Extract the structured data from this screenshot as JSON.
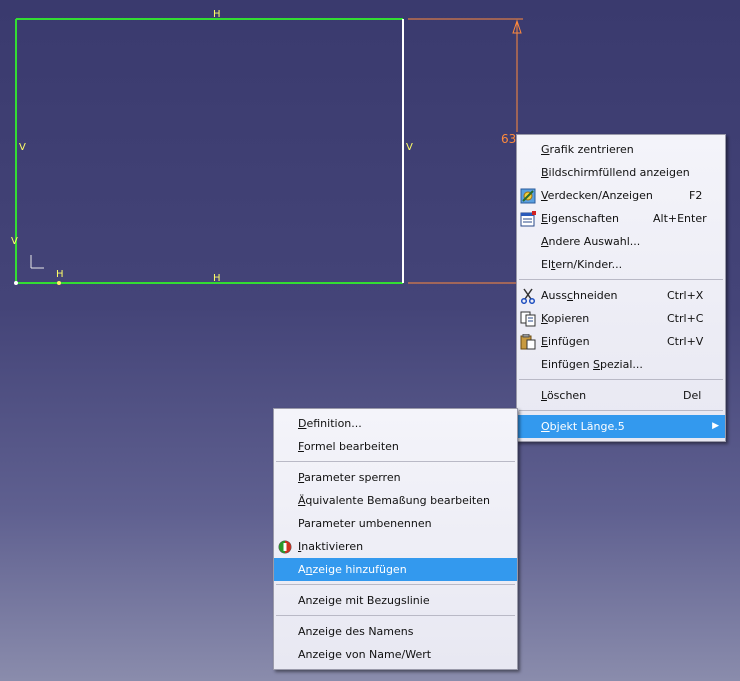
{
  "canvas": {
    "constraint_labels": {
      "top": "H",
      "bottom": "H",
      "left": "V",
      "right": "V",
      "origin_v": "V",
      "origin_h": "H"
    },
    "dimension_value": "63"
  },
  "context_menu": {
    "items": [
      {
        "pre": "",
        "u": "G",
        "post": "rafik zentrieren",
        "shortcut": ""
      },
      {
        "pre": "",
        "u": "B",
        "post": "ildschirmfüllend anzeigen",
        "shortcut": ""
      },
      {
        "pre": "",
        "u": "V",
        "post": "erdecken/Anzeigen",
        "shortcut": "F2"
      },
      {
        "pre": "",
        "u": "E",
        "post": "igenschaften",
        "shortcut": "Alt+Enter"
      },
      {
        "pre": "",
        "u": "A",
        "post": "ndere Auswahl...",
        "shortcut": ""
      },
      {
        "pre": "El",
        "u": "t",
        "post": "ern/Kinder...",
        "shortcut": ""
      },
      {
        "pre": "Auss",
        "u": "c",
        "post": "hneiden",
        "shortcut": "Ctrl+X"
      },
      {
        "pre": "",
        "u": "K",
        "post": "opieren",
        "shortcut": "Ctrl+C"
      },
      {
        "pre": "",
        "u": "E",
        "post": "infügen",
        "shortcut": "Ctrl+V"
      },
      {
        "pre": "Einfügen ",
        "u": "S",
        "post": "pezial...",
        "shortcut": ""
      },
      {
        "pre": "",
        "u": "L",
        "post": "öschen",
        "shortcut": "Del"
      },
      {
        "pre": "",
        "u": "O",
        "post": "bjekt Länge.5",
        "shortcut": ""
      }
    ]
  },
  "submenu": {
    "items": [
      {
        "pre": "",
        "u": "D",
        "post": "efinition..."
      },
      {
        "pre": "",
        "u": "F",
        "post": "ormel bearbeiten"
      },
      {
        "pre": "",
        "u": "P",
        "post": "arameter sperren"
      },
      {
        "pre": "",
        "u": "Ä",
        "post": "quivalente Bemaßung bearbeiten"
      },
      {
        "pre": "Parameter umbenennen",
        "u": "",
        "post": ""
      },
      {
        "pre": "",
        "u": "I",
        "post": "naktivieren"
      },
      {
        "pre": "A",
        "u": "n",
        "post": "zeige hinzufügen"
      },
      {
        "pre": "Anzeige mit Bezugslinie",
        "u": "",
        "post": ""
      },
      {
        "pre": "Anzeige des Namens",
        "u": "",
        "post": ""
      },
      {
        "pre": "Anzeige von Name/Wert",
        "u": "",
        "post": ""
      }
    ]
  },
  "colors": {
    "sketch_green": "#33dd33",
    "dimension_orange": "#ff8a3c",
    "highlight_blue": "#3399ee"
  },
  "icons": [
    "show-hide-icon",
    "properties-icon",
    "cut-icon",
    "copy-icon",
    "paste-icon",
    "deactivate-icon",
    "submenu-arrow-icon"
  ]
}
